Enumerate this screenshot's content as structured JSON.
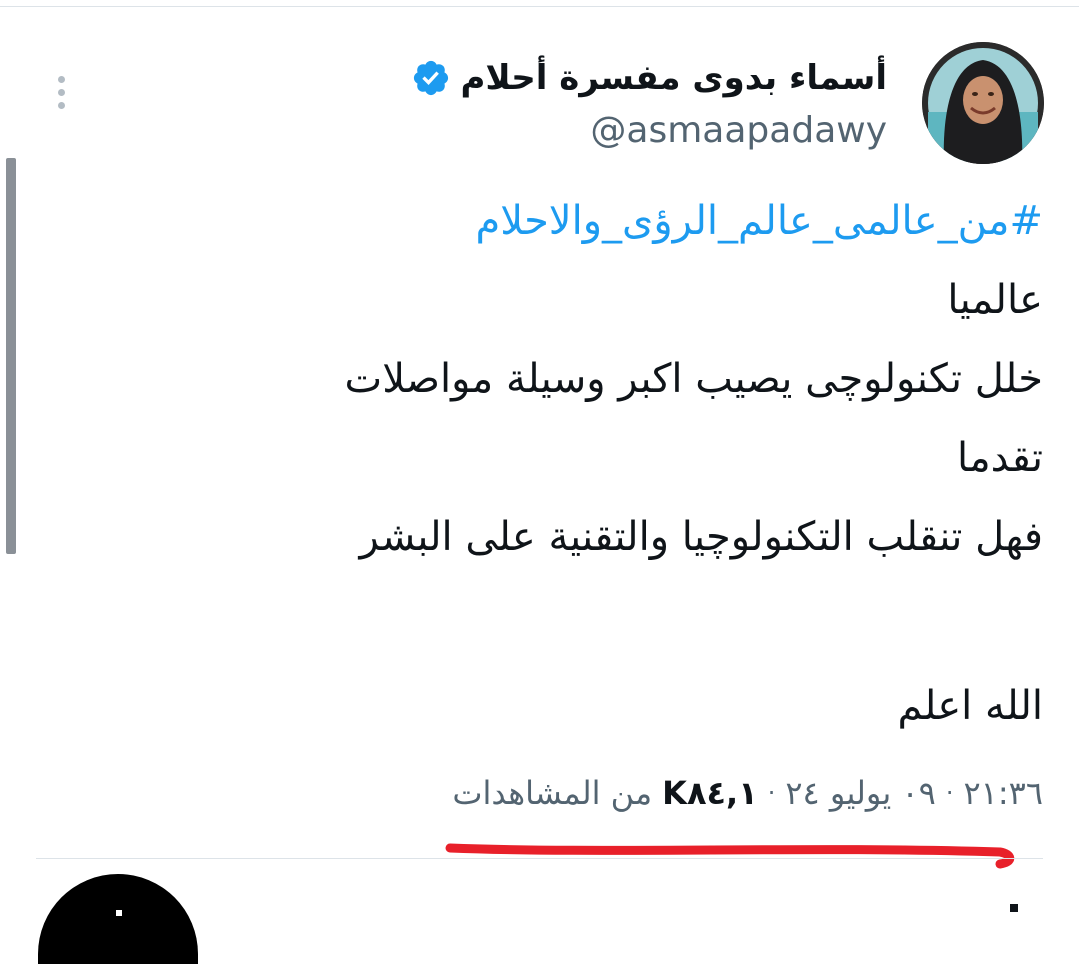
{
  "tweet": {
    "author": {
      "name": "أسماء بدوى مفسرة أحلام",
      "handle": "@asmaapadawy",
      "verified": true,
      "avatar_icon": "profile-photo-woman-hijab"
    },
    "menu_icon": "more-vertical-icon",
    "lines": [
      "#من_عالمى_عالم_الرؤى_والاحلام",
      "عالميا",
      "خلل تكنولوچى يصيب اكبر وسيلة مواصلات",
      "تقدما",
      "فهل تنقلب التكنولوچيا والتقنية على البشر",
      "",
      "الله اعلم"
    ],
    "meta": {
      "time": "٢١:٣٦",
      "date": "٠٩ يوليو ٢٤",
      "views_count": "K٨٤,١",
      "views_label": "من المشاهدات",
      "separator": "·"
    }
  },
  "colors": {
    "hashtag": "#1d9bf0",
    "verified": "#1d9bf0",
    "secondary_text": "#536471",
    "primary_text": "#0f1419",
    "underline_annotation": "#e8202a"
  }
}
